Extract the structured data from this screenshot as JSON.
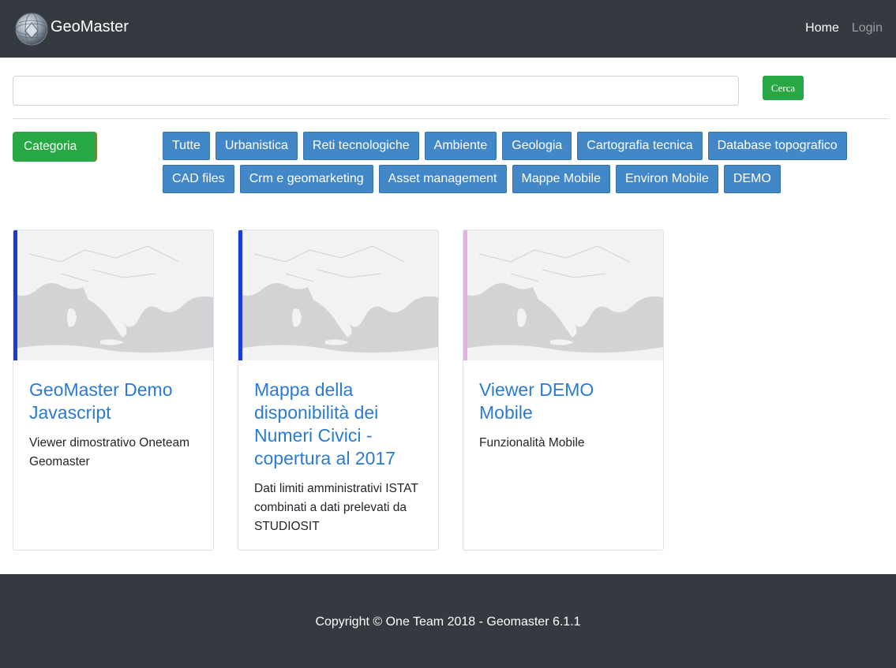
{
  "navbar": {
    "brand": "GeoMaster",
    "links": [
      {
        "label": "Home"
      },
      {
        "label": "Login"
      }
    ]
  },
  "search": {
    "value": "",
    "placeholder": "",
    "button_label": "Cerca"
  },
  "filters": {
    "category_label": "Categoria",
    "tags": [
      "Tutte",
      "Urbanistica",
      "Reti tecnologiche",
      "Ambiente",
      "Geologia",
      "Cartografia tecnica",
      "Database topografico",
      "CAD files",
      "Crm e geomarketing",
      "Asset management",
      "Mappe Mobile",
      "Environ Mobile",
      "DEMO"
    ]
  },
  "cards": [
    {
      "title": "GeoMaster Demo Javascript",
      "description": "Viewer dimostrativo Oneteam Geomaster",
      "accent": "#1a3bd6"
    },
    {
      "title": "Mappa della disponibilità dei Numeri Civici - copertura al 2017",
      "description": "Dati limiti amministrativi ISTAT combinati a dati prelevati da STUDIOSIT",
      "accent": "#1a3bd6"
    },
    {
      "title": "Viewer DEMO Mobile",
      "description": "Funzionalità Mobile",
      "accent": "#e6b3e0"
    }
  ],
  "footer": {
    "text": "Copyright © One Team 2018 - Geomaster 6.1.1"
  },
  "colors": {
    "navbar_bg": "#343a40",
    "success": "#28a745",
    "tag_bg": "#4287c7",
    "link": "#2a7bd3"
  },
  "icons": {
    "logo": "globe-logo-icon"
  }
}
